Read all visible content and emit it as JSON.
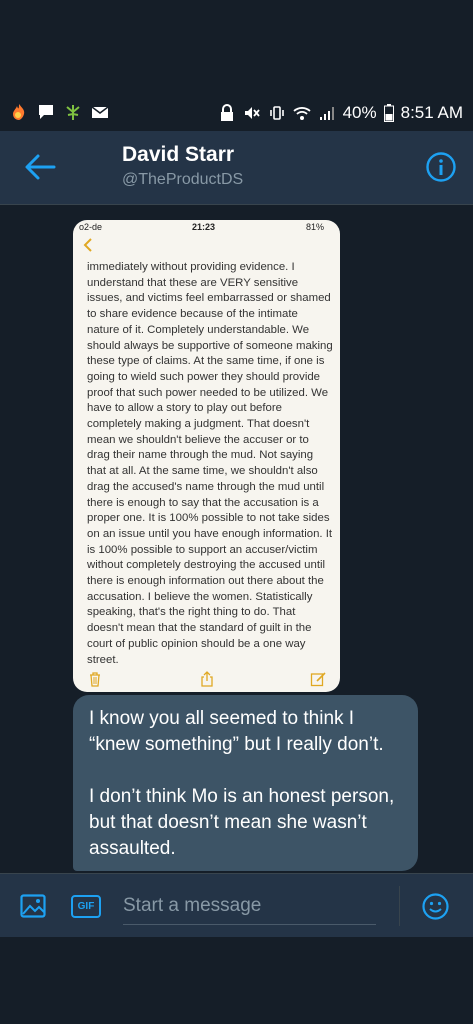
{
  "status_bar": {
    "battery": "40%",
    "time": "8:51 AM",
    "left_icons": [
      "flame-icon",
      "chat-icon",
      "leaf-icon",
      "mail-icon"
    ],
    "right_icons": [
      "lock-icon",
      "mute-icon",
      "vibrate-icon",
      "wifi-icon",
      "signal-icon",
      "battery-icon"
    ]
  },
  "header": {
    "name": "David Starr",
    "handle": "@TheProductDS"
  },
  "image_message": {
    "phone_status": {
      "carrier": "o2-de",
      "time": "21:23",
      "battery": "81%"
    },
    "note_ghost": "",
    "note_text": "immediately without providing evidence. I understand that these are VERY sensitive issues, and victims feel embarrassed or shamed to share evidence because of the intimate nature of it. Completely understandable. We should always be supportive of someone making these type of claims. At the same time, if one is going to wield such power they should provide proof that such power needed to be utilized. We have to allow a story to play out before completely making a judgment. That doesn't mean we shouldn't believe the accuser or to drag their name through the mud. Not saying that at all. At the same time, we shouldn't also drag the accused's name through the mud until there is enough to say that the accusation is a proper one. It is 100% possible to not take sides on an issue until you have enough information. It is 100% possible to support an accuser/victim without completely destroying the accused until there is enough information out there about the accusation. I believe the women. Statistically speaking, that's the right thing to do. That doesn't mean that the standard of guilt in the court of public opinion should be a one way street."
  },
  "text_message": {
    "paragraph1": "I know you all seemed to think I “knew something” but I really don’t.",
    "paragraph2": "I don’t think Mo is an honest person, but that doesn’t mean she wasn’t assaulted."
  },
  "composer": {
    "placeholder": "Start a message",
    "gif_label": "GIF"
  },
  "colors": {
    "accent": "#1da1f2",
    "header_bg": "#243447",
    "background": "#151e28",
    "bubble": "#3d5466"
  }
}
